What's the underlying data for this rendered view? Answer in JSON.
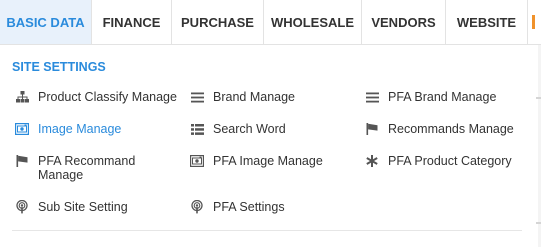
{
  "tabs": [
    {
      "label": "BASIC DATA",
      "active": true
    },
    {
      "label": "FINANCE",
      "active": false
    },
    {
      "label": "PURCHASE",
      "active": false
    },
    {
      "label": "WHOLESALE",
      "active": false
    },
    {
      "label": "VENDORS",
      "active": false
    },
    {
      "label": "WEBSITE",
      "active": false
    }
  ],
  "section": {
    "title": "SITE SETTINGS"
  },
  "items": [
    {
      "label": "Product Classify Manage",
      "icon": "hierarchy-icon"
    },
    {
      "label": "Brand Manage",
      "icon": "list-icon"
    },
    {
      "label": "PFA Brand Manage",
      "icon": "list-icon"
    },
    {
      "label": "Image Manage",
      "icon": "image-icon",
      "active": true
    },
    {
      "label": "Search Word",
      "icon": "table-list-icon"
    },
    {
      "label": "Recommands Manage",
      "icon": "flag-icon"
    },
    {
      "label": "PFA Recommand Manage",
      "icon": "flag-icon"
    },
    {
      "label": "PFA Image Manage",
      "icon": "image-icon"
    },
    {
      "label": "PFA Product Category",
      "icon": "asterisk-icon"
    },
    {
      "label": "Sub Site Setting",
      "icon": "podcast-icon"
    },
    {
      "label": "PFA Settings",
      "icon": "podcast-icon"
    }
  ],
  "colors": {
    "accent": "#2a8bdc",
    "active_tab_bg": "#e8f1fb",
    "text": "#333333",
    "icon": "#555555",
    "next_tab_marker": "#f0922b"
  }
}
